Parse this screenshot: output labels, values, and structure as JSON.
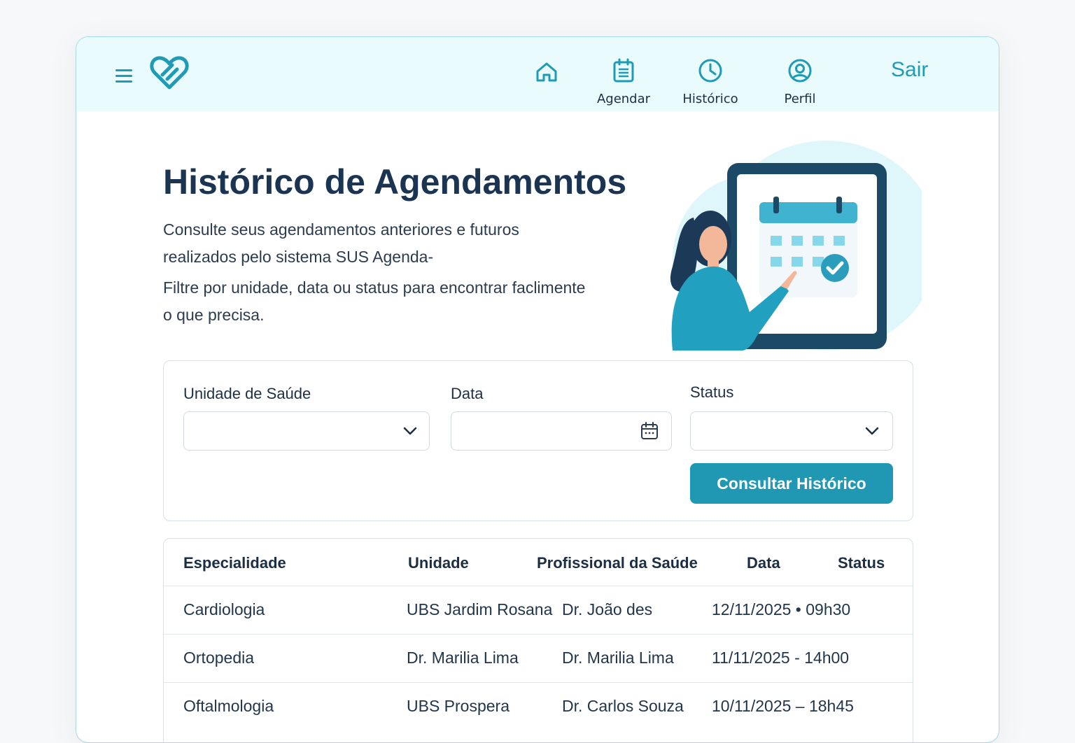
{
  "header": {
    "nav": [
      {
        "id": "home",
        "label": "",
        "icon": "home-icon"
      },
      {
        "id": "agendar",
        "label": "Agendar",
        "icon": "calendar-list-icon"
      },
      {
        "id": "historico",
        "label": "Histórico",
        "icon": "clock-icon"
      },
      {
        "id": "perfil",
        "label": "Perfil",
        "icon": "user-circle-icon"
      }
    ],
    "logout_label": "Sair",
    "menu_icon": "hamburger-menu-icon",
    "logo_icon": "heart-logo-icon"
  },
  "hero": {
    "title": "Histórico de Agendamentos",
    "paragraph_1": "Consulte seus agendamentos anteriores e futuros realizados pelo sistema SUS Agenda-",
    "paragraph_2": "Filtre por unidade, data ou status para encontrar faclimente o que precisa."
  },
  "filters": {
    "unidade_label": "Unidade de Saúde",
    "unidade_value": "",
    "data_label": "Data",
    "data_value": "",
    "status_label": "Status",
    "status_value": "",
    "submit_label": "Consultar Histórico"
  },
  "table": {
    "columns": [
      "Especialidade",
      "Unidade",
      "Profissional da Saúde",
      "Data",
      "Status"
    ],
    "rows": [
      {
        "especialidade": "Cardiologia",
        "unidade": "UBS Jardim Rosana",
        "profissional": "Dr. João des",
        "data": "12/11/2025 • 09h30",
        "status": ""
      },
      {
        "especialidade": "Ortopedia",
        "unidade": "Dr. Marilia Lima",
        "profissional": "Dr. Marilia Lima",
        "data": "11/11/2025 - 14h00",
        "status": ""
      },
      {
        "especialidade": "Oftalmologia",
        "unidade": "UBS Prospera",
        "profissional": "Dr. Carlos Souza",
        "data": "10/11/2025 – 18h45",
        "status": ""
      }
    ]
  },
  "colors": {
    "accent": "#2198b3",
    "header_bg": "#e9fbfc",
    "title": "#1b3451"
  }
}
